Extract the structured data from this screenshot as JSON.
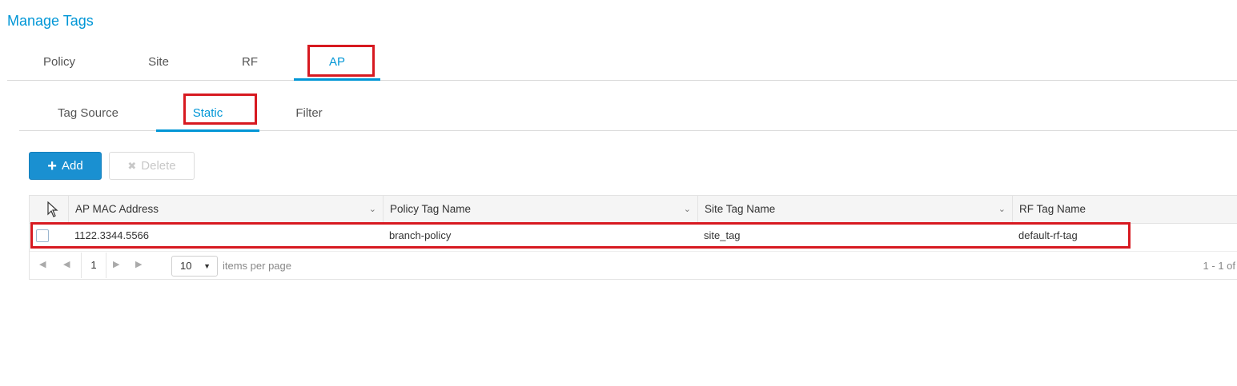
{
  "page": {
    "title": "Manage Tags"
  },
  "tabs": [
    "Policy",
    "Site",
    "RF",
    "AP"
  ],
  "active_tab": "AP",
  "subtabs": [
    "Tag Source",
    "Static",
    "Filter"
  ],
  "active_subtab": "Static",
  "toolbar": {
    "add_label": "Add",
    "delete_label": "Delete"
  },
  "grid": {
    "columns": [
      "AP MAC Address",
      "Policy Tag Name",
      "Site Tag Name",
      "RF Tag Name"
    ],
    "rows": [
      {
        "ap_mac": "1122.3344.5566",
        "policy_tag": "branch-policy",
        "site_tag": "site_tag",
        "rf_tag": "default-rf-tag"
      }
    ]
  },
  "pager": {
    "current_page": "1",
    "page_size": "10",
    "items_per_page_label": "items per page",
    "range_text": "1 - 1 of"
  },
  "colors": {
    "accent": "#0096d6",
    "highlight": "#d71920",
    "primary_button": "#1a90d1"
  }
}
